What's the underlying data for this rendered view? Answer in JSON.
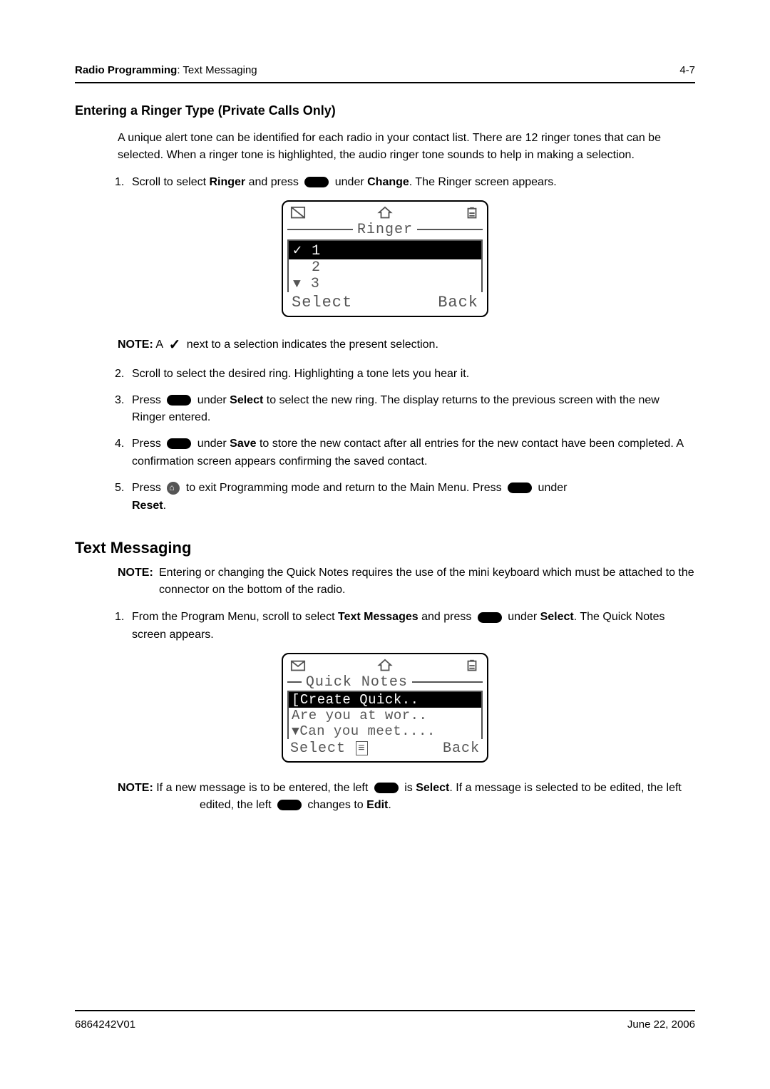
{
  "header": {
    "breadcrumb_bold": "Radio Programming",
    "breadcrumb_rest": ": Text Messaging",
    "page_num": "4-7"
  },
  "section1": {
    "heading": "Entering a Ringer Type (Private Calls Only)",
    "intro": "A unique alert tone can be identified for each radio in your contact list. There are 12 ringer tones that can be selected. When a ringer tone is highlighted, the audio ringer tone sounds to help in making a selection.",
    "step1_pre": "Scroll to select ",
    "step1_ringer": "Ringer",
    "step1_mid": " and press ",
    "step1_mid2": " under ",
    "step1_change": "Change",
    "step1_end": ". The Ringer screen appears.",
    "screen": {
      "title": "Ringer",
      "items": [
        "1",
        "2",
        "3"
      ],
      "left_soft": "Select",
      "right_soft": "Back"
    },
    "note1_label": "NOTE:",
    "note1_pre": "A ",
    "note1_post": " next to a selection indicates the present selection.",
    "step2": "Scroll to select the desired ring. Highlighting a tone lets you hear it.",
    "step3_pre": "Press ",
    "step3_mid": " under ",
    "step3_select": "Select",
    "step3_end": " to select the new ring. The display returns to the previous screen with the new Ringer entered.",
    "step4_pre": "Press ",
    "step4_mid": " under ",
    "step4_save": "Save",
    "step4_end": " to store the new contact after all entries for the new contact have been completed. A confirmation screen appears confirming the saved contact.",
    "step5_pre": "Press ",
    "step5_mid": " to exit Programming mode and return to the Main Menu. Press ",
    "step5_mid2": " under ",
    "step5_reset": "Reset",
    "step5_end": "."
  },
  "section2": {
    "heading": "Text Messaging",
    "note_label": "NOTE:",
    "note_text": "Entering or changing the Quick Notes requires the use of the mini keyboard which must be attached to the connector on the bottom of the radio.",
    "step1_pre": "From the Program Menu, scroll to select ",
    "step1_tm": "Text Messages",
    "step1_mid": " and press ",
    "step1_mid2": " under ",
    "step1_select": "Select",
    "step1_end": ". The Quick Notes screen appears.",
    "screen": {
      "title": "Quick Notes",
      "item1": "[Create Quick..",
      "item2": "Are you at wor..",
      "item3": "Can you meet....",
      "left_soft": "Select",
      "right_soft": "Back"
    },
    "note2_label": "NOTE:",
    "note2_pre": "If a new message is to be entered, the left ",
    "note2_mid": " is ",
    "note2_select": "Select",
    "note2_mid2": ". If a message is selected to be edited, the left ",
    "note2_mid3": " changes to ",
    "note2_edit": "Edit",
    "note2_end": "."
  },
  "footer": {
    "doc_id": "6864242V01",
    "date": "June 22, 2006"
  }
}
